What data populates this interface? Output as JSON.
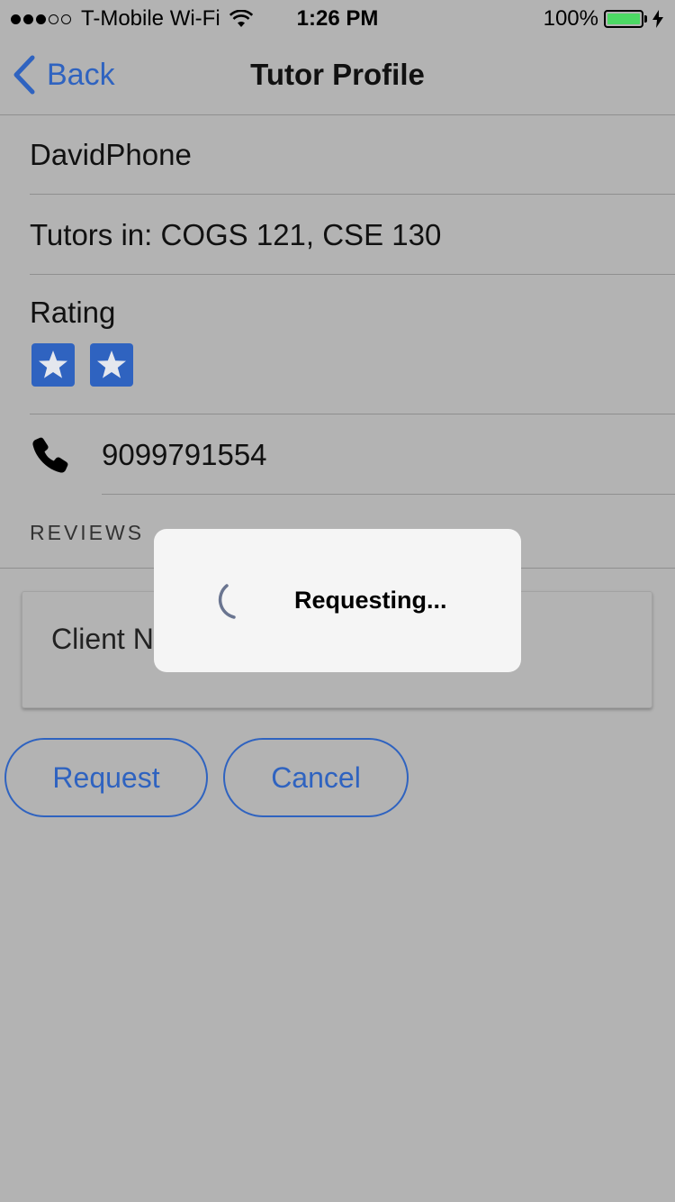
{
  "status_bar": {
    "carrier": "T-Mobile Wi-Fi",
    "time": "1:26 PM",
    "battery": "100%",
    "signal_bars": 3,
    "signal_total": 5,
    "battery_color": "#4cd964"
  },
  "nav": {
    "back_label": "Back",
    "title": "Tutor Profile"
  },
  "profile": {
    "name": "DavidPhone",
    "tutors_in": "Tutors in: COGS 121, CSE 130",
    "rating_label": "Rating",
    "rating_stars": 2,
    "phone": "9099791554"
  },
  "reviews": {
    "header": "REVIEWS",
    "items": [
      {
        "client_name": "Client N"
      }
    ]
  },
  "actions": {
    "request_label": "Request",
    "cancel_label": "Cancel"
  },
  "hud": {
    "message": "Requesting..."
  },
  "colors": {
    "accent": "#2f63c0",
    "background": "#b3b3b3",
    "hud_background": "#f5f5f5"
  },
  "icons": [
    "wifi-icon",
    "bolt-icon",
    "back-chevron-icon",
    "star-icon",
    "phone-icon",
    "spinner-icon"
  ]
}
